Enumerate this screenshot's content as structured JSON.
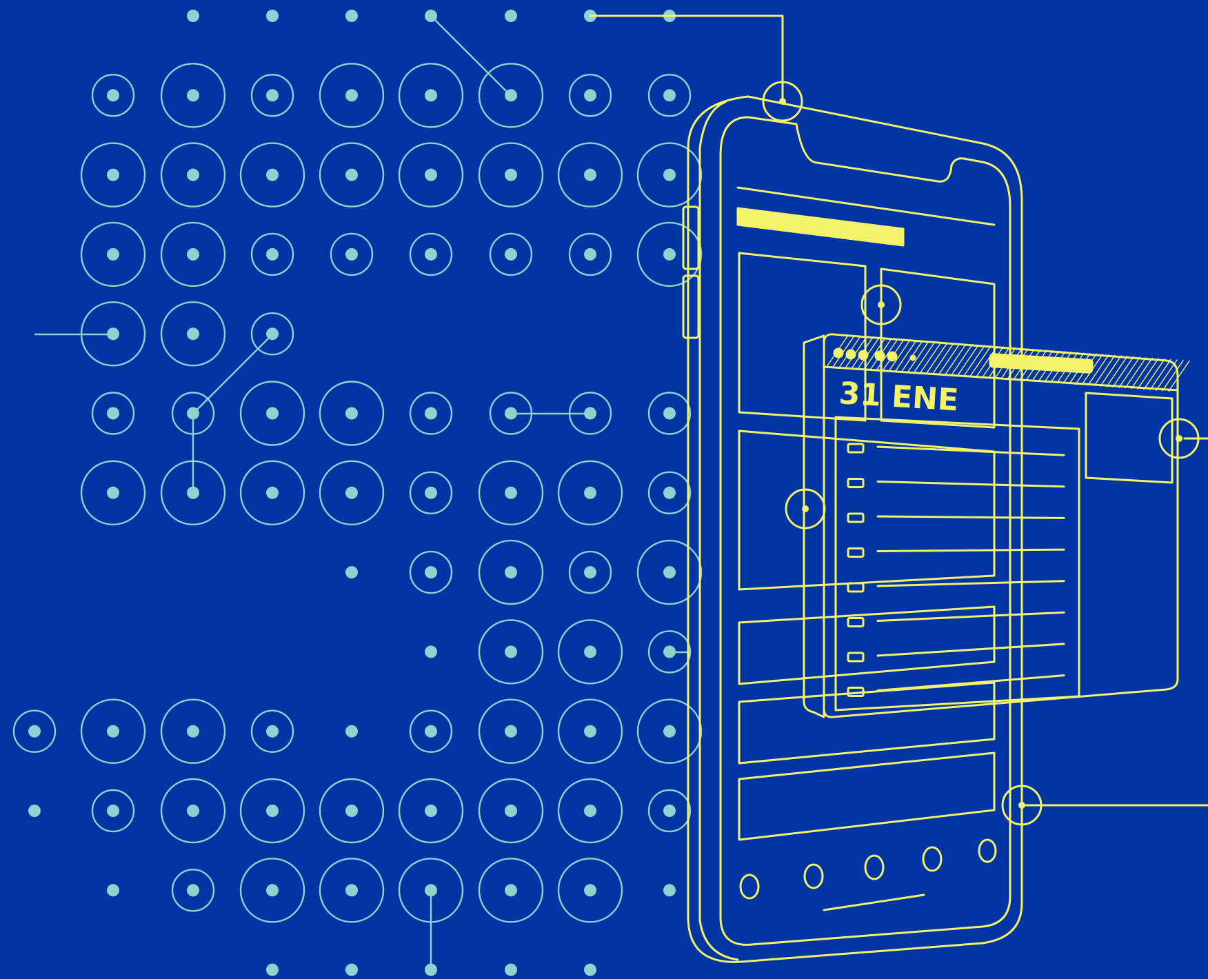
{
  "calendar_card": {
    "date_label": "31 ENE"
  },
  "colors": {
    "background": "#0035a3",
    "dot_pattern": "#8fd3cf",
    "line_art": "#f2f36b"
  }
}
